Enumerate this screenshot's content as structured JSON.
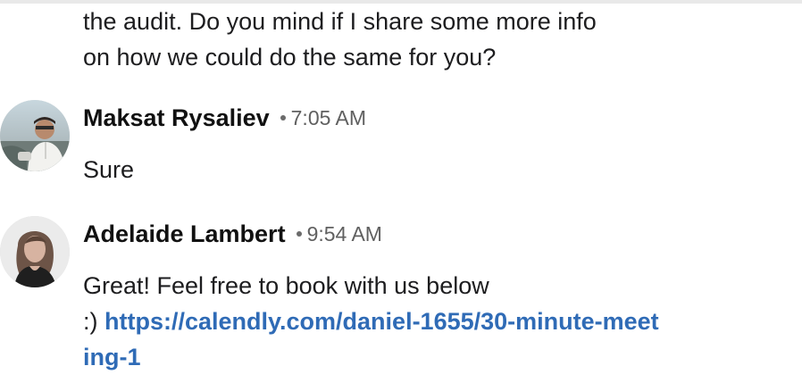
{
  "conversation": {
    "previous_message_tail": "the audit. Do you mind if I share some more info\non how we could do the same for you?",
    "messages": [
      {
        "author": "Maksat Rysaliev",
        "time": "7:05 AM",
        "avatar": "profile-photo-man-outdoors",
        "text": "Sure"
      },
      {
        "author": "Adelaide Lambert",
        "time": "9:54 AM",
        "avatar": "profile-photo-woman-portrait",
        "text_prefix": "Great! Feel free to book with us below\n:) ",
        "link": "https://calendly.com/daniel-1655/30-minute-meeting-1"
      }
    ]
  },
  "colors": {
    "link": "#2f6bb6",
    "text": "#1d1d1f",
    "timestamp": "#606060"
  }
}
